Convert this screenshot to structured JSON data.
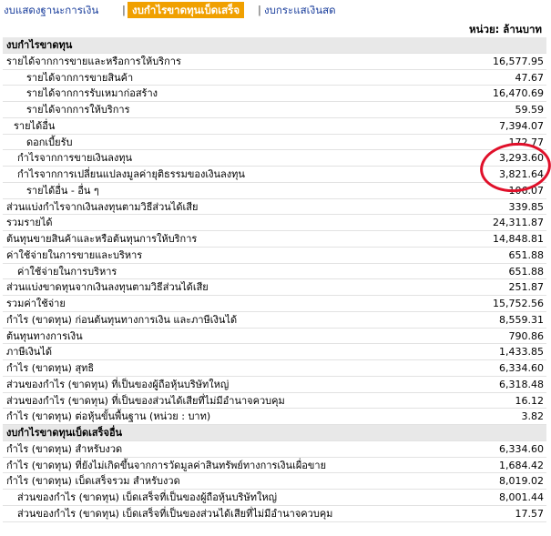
{
  "tabs": {
    "balance_sheet": "งบแสดงฐานะการเงิน",
    "income_statement": "งบกำไรขาดทุนเบ็ดเสร็จ",
    "cash_flow": "งบกระแสเงินสด",
    "separator": "|"
  },
  "unit_label": "หน่วย: ล้านบาท",
  "rows": [
    {
      "label": "งบกำไรขาดทุน",
      "value": "",
      "style": "head"
    },
    {
      "label": "รายได้จากการขายและหรือการให้บริการ",
      "value": "16,577.95",
      "style": "lvl0"
    },
    {
      "label": "รายได้จากการขายสินค้า",
      "value": "47.67",
      "style": "i1"
    },
    {
      "label": "รายได้จากการรับเหมาก่อสร้าง",
      "value": "16,470.69",
      "style": "i1"
    },
    {
      "label": "รายได้จากการให้บริการ",
      "value": "59.59",
      "style": "i1"
    },
    {
      "label": "รายได้อื่น",
      "value": "7,394.07",
      "style": "i2"
    },
    {
      "label": "ดอกเบี้ยรับ",
      "value": "172.77",
      "style": "i1"
    },
    {
      "label": "กำไรจากการขายเงินลงทุน",
      "value": "3,293.60",
      "style": "i3"
    },
    {
      "label": "กำไรจากการเปลี่ยนแปลงมูลค่ายุติธรรมของเงินลงทุน",
      "value": "3,821.64",
      "style": "i3"
    },
    {
      "label": "รายได้อื่น - อื่น ๆ",
      "value": "106.07",
      "style": "i1"
    },
    {
      "label": "ส่วนแบ่งกำไรจากเงินลงทุนตามวิธีส่วนได้เสีย",
      "value": "339.85",
      "style": "lvl0"
    },
    {
      "label": "รวมรายได้",
      "value": "24,311.87",
      "style": "lvl0"
    },
    {
      "label": "ต้นทุนขายสินค้าและหรือต้นทุนการให้บริการ",
      "value": "14,848.81",
      "style": "lvl0"
    },
    {
      "label": "ค่าใช้จ่ายในการขายและบริหาร",
      "value": "651.88",
      "style": "lvl0"
    },
    {
      "label": "ค่าใช้จ่ายในการบริหาร",
      "value": "651.88",
      "style": "i3"
    },
    {
      "label": "ส่วนแบ่งขาดทุนจากเงินลงทุนตามวิธีส่วนได้เสีย",
      "value": "251.87",
      "style": "lvl0"
    },
    {
      "label": "รวมค่าใช้จ่าย",
      "value": "15,752.56",
      "style": "lvl0"
    },
    {
      "label": "กำไร (ขาดทุน) ก่อนต้นทุนทางการเงิน และภาษีเงินได้",
      "value": "8,559.31",
      "style": "lvl0"
    },
    {
      "label": "ต้นทุนทางการเงิน",
      "value": "790.86",
      "style": "lvl0"
    },
    {
      "label": "ภาษีเงินได้",
      "value": "1,433.85",
      "style": "lvl0"
    },
    {
      "label": "กำไร (ขาดทุน) สุทธิ",
      "value": "6,334.60",
      "style": "lvl0"
    },
    {
      "label": "ส่วนของกำไร (ขาดทุน) ที่เป็นของผู้ถือหุ้นบริษัทใหญ่",
      "value": "6,318.48",
      "style": "lvl0"
    },
    {
      "label": "ส่วนของกำไร (ขาดทุน) ที่เป็นของส่วนได้เสียที่ไม่มีอำนาจควบคุม",
      "value": "16.12",
      "style": "lvl0"
    },
    {
      "label": "กำไร (ขาดทุน) ต่อหุ้นขั้นพื้นฐาน (หน่วย : บาท)",
      "value": "3.82",
      "style": "lvl0"
    },
    {
      "label": "งบกำไรขาดทุนเบ็ดเสร็จอื่น",
      "value": "",
      "style": "head"
    },
    {
      "label": "กำไร (ขาดทุน) สำหรับงวด",
      "value": "6,334.60",
      "style": "lvl0"
    },
    {
      "label": "กำไร (ขาดทุน) ที่ยังไม่เกิดขึ้นจากการวัดมูลค่าสินทรัพย์ทางการเงินเผื่อขาย",
      "value": "1,684.42",
      "style": "lvl0"
    },
    {
      "label": "กำไร (ขาดทุน) เบ็ดเสร็จรวม สำหรับงวด",
      "value": "8,019.02",
      "style": "lvl0"
    },
    {
      "label": "ส่วนของกำไร (ขาดทุน) เบ็ดเสร็จที่เป็นของผู้ถือหุ้นบริษัทใหญ่",
      "value": "8,001.44",
      "style": "i3"
    },
    {
      "label": "ส่วนของกำไร (ขาดทุน) เบ็ดเสร็จที่เป็นของส่วนได้เสียที่ไม่มีอำนาจควบคุม",
      "value": "17.57",
      "style": "i3"
    }
  ],
  "colors": {
    "active_tab_bg": "#f0a000",
    "tab_link": "#1a3e9c",
    "header_bg": "#e8e8e8",
    "highlight_circle": "#e0102a"
  }
}
